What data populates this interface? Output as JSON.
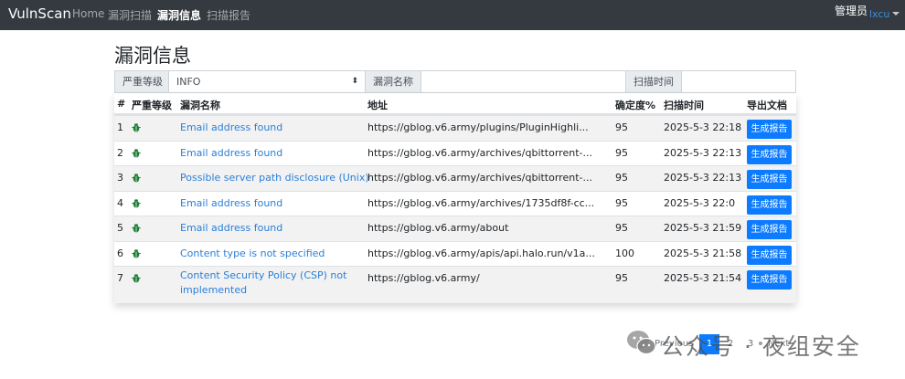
{
  "navbar": {
    "brand": "VulnScan",
    "links": [
      {
        "label": "Home",
        "active": false
      },
      {
        "label": "漏洞扫描",
        "active": false
      },
      {
        "label": "漏洞信息",
        "active": true
      },
      {
        "label": "扫描报告",
        "active": false
      }
    ],
    "user_role": "管理员",
    "user_name": "lxcu"
  },
  "page": {
    "title": "漏洞信息"
  },
  "filters": {
    "severity_label": "严重等级",
    "severity_value": "INFO",
    "name_label": "漏洞名称",
    "name_value": "",
    "time_label": "扫描时间",
    "time_value": ""
  },
  "table": {
    "headers": [
      "#",
      "严重等级",
      "漏洞名称",
      "地址",
      "确定度%",
      "扫描时间",
      "导出文档"
    ],
    "rows": [
      {
        "index": "1",
        "severity": "info",
        "name": "Email address found",
        "address": "https://gblog.v6.army/plugins/PluginHighli...",
        "confidence": "95",
        "time": "2025-5-3 22:18",
        "action": "生成报告"
      },
      {
        "index": "2",
        "severity": "info",
        "name": "Email address found",
        "address": "https://gblog.v6.army/archives/qbittorrent-...",
        "confidence": "95",
        "time": "2025-5-3 22:13",
        "action": "生成报告"
      },
      {
        "index": "3",
        "severity": "info",
        "name": "Possible server path disclosure (Unix)",
        "address": "https://gblog.v6.army/archives/qbittorrent-...",
        "confidence": "95",
        "time": "2025-5-3 22:13",
        "action": "生成报告"
      },
      {
        "index": "4",
        "severity": "info",
        "name": "Email address found",
        "address": "https://gblog.v6.army/archives/1735df8f-cc...",
        "confidence": "95",
        "time": "2025-5-3 22:0",
        "action": "生成报告"
      },
      {
        "index": "5",
        "severity": "info",
        "name": "Email address found",
        "address": "https://gblog.v6.army/about",
        "confidence": "95",
        "time": "2025-5-3 21:59",
        "action": "生成报告"
      },
      {
        "index": "6",
        "severity": "info",
        "name": "Content type is not specified",
        "address": "https://gblog.v6.army/apis/api.halo.run/v1a...",
        "confidence": "100",
        "time": "2025-5-3 21:58",
        "action": "生成报告"
      },
      {
        "index": "7",
        "severity": "info",
        "name": "Content Security Policy (CSP) not implemented",
        "address": "https://gblog.v6.army/",
        "confidence": "95",
        "time": "2025-5-3 21:54",
        "action": "生成报告"
      }
    ]
  },
  "pagination": {
    "previous": "Previous",
    "pages": [
      "1",
      "2",
      "3"
    ],
    "active_page": "1",
    "next": "Next"
  },
  "watermark": {
    "text": "公众号 · 夜组安全",
    "icon": "wechat-logo-icon"
  },
  "colors": {
    "navbar_bg": "#343a40",
    "link": "#2a7fd9",
    "button_primary": "#0d7bff",
    "severity_icon": "#1e7e34"
  }
}
